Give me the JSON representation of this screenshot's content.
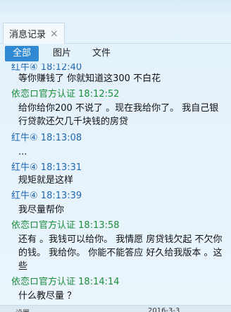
{
  "tab": {
    "label": "消息记录",
    "close": "×"
  },
  "filters": [
    "全部",
    "图片",
    "文件"
  ],
  "history": [
    {
      "sender": "红牛④",
      "time": "18:12:40",
      "text": "等你赚钱了 你就知道这300 不白花",
      "color": "blue"
    },
    {
      "sender": "依恋ロ官方认证",
      "time": "18:12:52",
      "text": "给你给你200 不说了 。现在我给你了。 我自己银行贷款还欠几千块钱的房贷",
      "color": "green"
    },
    {
      "sender": "红牛④",
      "time": "18:13:08",
      "text": "...",
      "color": "blue"
    },
    {
      "sender": "红牛④",
      "time": "18:13:31",
      "text": "规矩就是这样",
      "color": "blue"
    },
    {
      "sender": "红牛④",
      "time": "18:13:39",
      "text": "我尽量帮你",
      "color": "blue"
    },
    {
      "sender": "依恋ロ官方认证",
      "time": "18:13:58",
      "text": "还有 。我钱可以给你。 我情愿 房贷钱欠起 不欠你的钱。 我给你。 你能不能答应 好久给我版本 。这些",
      "color": "green"
    },
    {
      "sender": "依恋ロ官方认证",
      "time": "18:14:14",
      "text": "什么教尽量 ？",
      "color": "green"
    }
  ],
  "bottom": {
    "settings": "设置",
    "date": "2016-3-3"
  },
  "colors": {
    "accent": "#2f8ad3",
    "green_sender": "#1b8d3b",
    "blue_sender": "#1f67b0"
  }
}
